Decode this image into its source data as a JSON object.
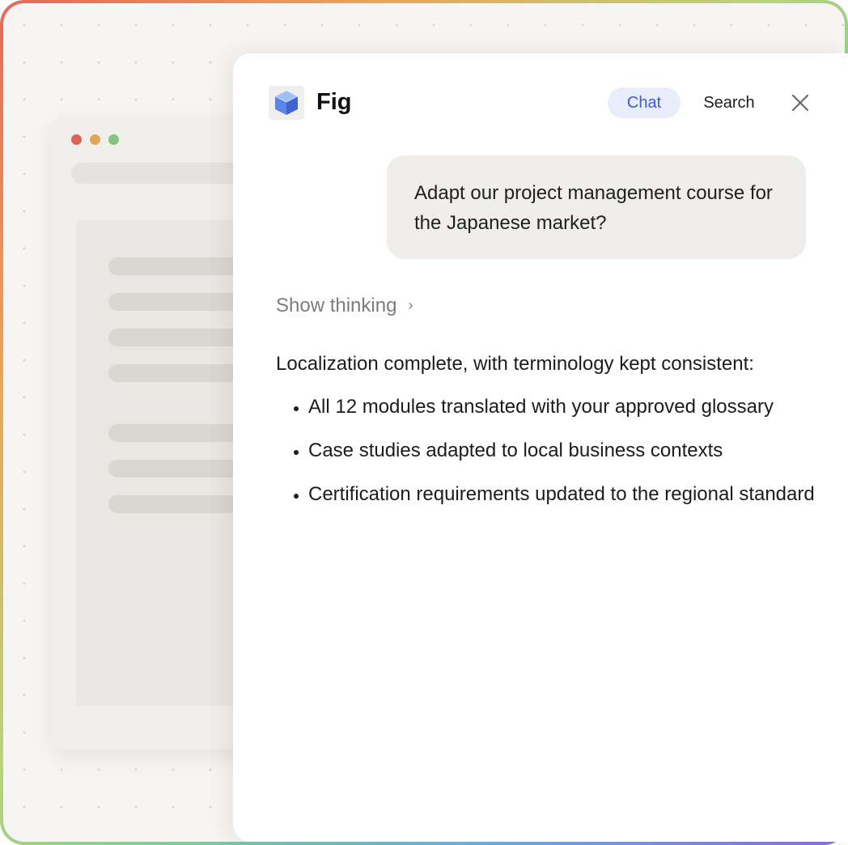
{
  "app": {
    "name": "Fig",
    "logo_icon": "cube-icon"
  },
  "tabs": {
    "chat_label": "Chat",
    "search_label": "Search",
    "active": "Chat"
  },
  "colors": {
    "accent": "#3b5bdb",
    "accent_bg": "#e8ecfb",
    "bubble_bg": "#efeeeb"
  },
  "conversation": {
    "user_message": "Adapt our project management course for the Japanese market?",
    "show_thinking_label": "Show thinking",
    "response_intro": "Localization complete, with terminology kept consistent:",
    "response_items": [
      "All 12 modules translated with your approved glossary",
      "Case studies adapted to local business contexts",
      "Certification requirements updated to the regional standard"
    ]
  }
}
